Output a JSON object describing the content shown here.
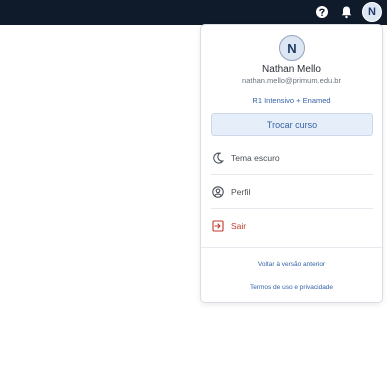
{
  "header": {
    "help_icon": "help-icon",
    "bell_icon": "bell-icon",
    "avatar_initial": "N"
  },
  "menu": {
    "avatar_initial": "N",
    "name": "Nathan Mello",
    "email": "nathan.mello@primum.edu.br",
    "course": "R1 Intensivo + Enamed",
    "switch_course": "Trocar curso",
    "items": [
      {
        "label": "Tema escuro",
        "icon": "moon-icon"
      },
      {
        "label": "Perfil",
        "icon": "user-circle-icon"
      },
      {
        "label": "Sair",
        "icon": "logout-icon"
      }
    ],
    "links": {
      "old_version": "Voltar à versão anterior",
      "terms": "Termos de uso e privacidade"
    }
  },
  "colors": {
    "topbar": "#0f1a2b",
    "accent": "#3563a8",
    "danger": "#c0392b",
    "button_bg": "#e6eef9"
  }
}
